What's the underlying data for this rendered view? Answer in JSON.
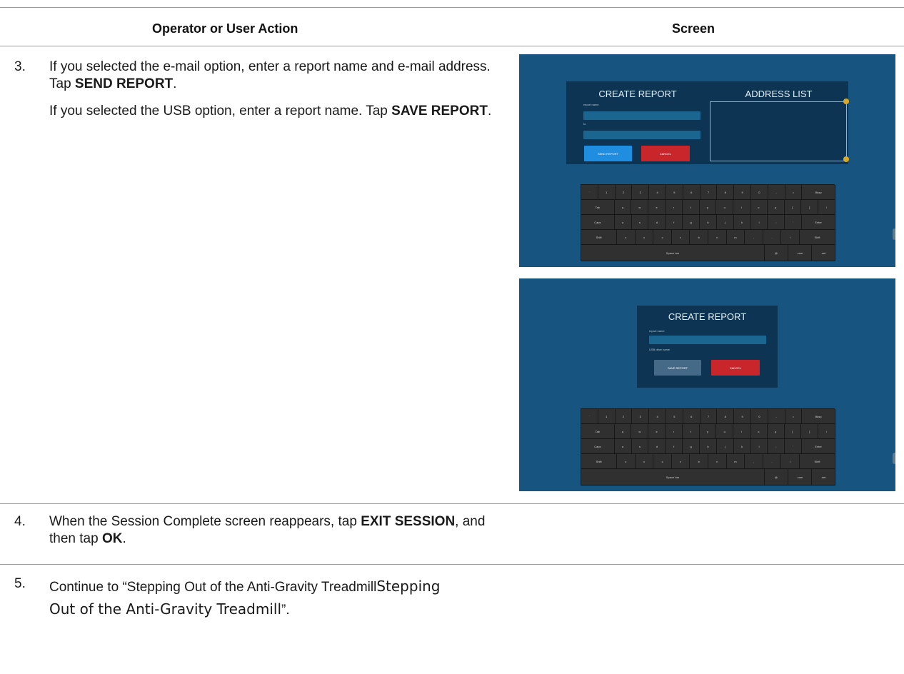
{
  "header": {
    "left": "Operator or User Action",
    "right": "Screen"
  },
  "steps": {
    "s3": {
      "num": "3.",
      "p1_a": "If you selected the e-mail option, enter a report name and e-mail address. Tap ",
      "p1_b": "SEND REPORT",
      "p1_c": ".",
      "p2_a": "If you selected the USB option, enter a report name. Tap ",
      "p2_b": "SAVE REPORT",
      "p2_c": "."
    },
    "s4": {
      "num": "4.",
      "a": "When the Session Complete screen reappears, tap ",
      "b": "EXIT SESSION",
      "c": ", and then tap ",
      "d": "OK",
      "e": "."
    },
    "s5": {
      "num": "5.",
      "a": "Continue to “Stepping Out of the Anti-Gravity Treadmill",
      "b": "Stepping Out of the Anti-Gravity Treadmill",
      "c": "”."
    }
  },
  "screen1": {
    "title_create": "CREATE REPORT",
    "title_address": "ADDRESS LIST",
    "label_name": "report name",
    "label_to": "to",
    "send_button": "SEND REPORT",
    "cancel_button": "CANCEL"
  },
  "screen2": {
    "title_create": "CREATE REPORT",
    "label_name": "report name",
    "label_usb": "USB drive name",
    "save_button": "SAVE REPORT",
    "cancel_button": "CANCEL"
  },
  "keyboard": {
    "row1": [
      "`",
      "1",
      "2",
      "3",
      "4",
      "5",
      "6",
      "7",
      "8",
      "9",
      "0",
      "-",
      "=",
      "Bksp"
    ],
    "row2": [
      "Tab",
      "q",
      "w",
      "e",
      "r",
      "t",
      "y",
      "u",
      "i",
      "o",
      "p",
      "[",
      "]",
      "\\"
    ],
    "row3": [
      "Caps",
      "a",
      "s",
      "d",
      "f",
      "g",
      "h",
      "j",
      "k",
      "l",
      ";",
      "'",
      "Enter"
    ],
    "row4": [
      "Shift",
      "z",
      "x",
      "c",
      "v",
      "b",
      "n",
      "m",
      ",",
      ".",
      "/",
      "Shift"
    ],
    "row5": [
      "Space bar",
      "@",
      ".com",
      ".net"
    ]
  },
  "colors": {
    "screen_bg": "#175580",
    "panel_bg": "#0d3452",
    "send_blue": "#1f8ee0",
    "cancel_red": "#c9262c",
    "save_gray": "#456a88",
    "accent_dot": "#d8a928"
  }
}
